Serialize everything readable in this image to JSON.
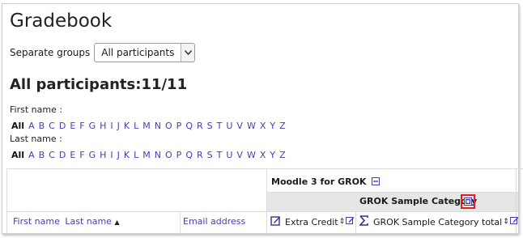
{
  "page": {
    "title": "Gradebook",
    "groups_label": "Separate groups",
    "groups_selected": "All participants",
    "subtitle": "All participants:11/11",
    "first_name_label": "First name :",
    "last_name_label": "Last name :"
  },
  "alphabet": {
    "all": "All",
    "letters": [
      "A",
      "B",
      "C",
      "D",
      "E",
      "F",
      "G",
      "H",
      "I",
      "J",
      "K",
      "L",
      "M",
      "N",
      "O",
      "P",
      "Q",
      "R",
      "S",
      "T",
      "U",
      "V",
      "W",
      "X",
      "Y",
      "Z"
    ]
  },
  "table": {
    "course_header": "Moodle 3 for GROK",
    "category_header": "GROK Sample Category",
    "col_first_name": "First name",
    "col_last_name": "Last name",
    "col_email": "Email address",
    "col_extra_credit": "Extra Credit",
    "col_category_total": "GROK Sample Category total",
    "sort_indicator": "▲",
    "sort_both": "⇕"
  },
  "icons": {
    "select_arrow": "chevron-down-icon",
    "collapse": "collapse-icon",
    "expand": "expand-icon",
    "edit": "edit-icon",
    "assignment": "assignment-icon",
    "sum": "sum-icon"
  },
  "colors": {
    "link": "#4a3ab8",
    "highlight": "#e02020",
    "category_bg": "#e6e6e6"
  }
}
